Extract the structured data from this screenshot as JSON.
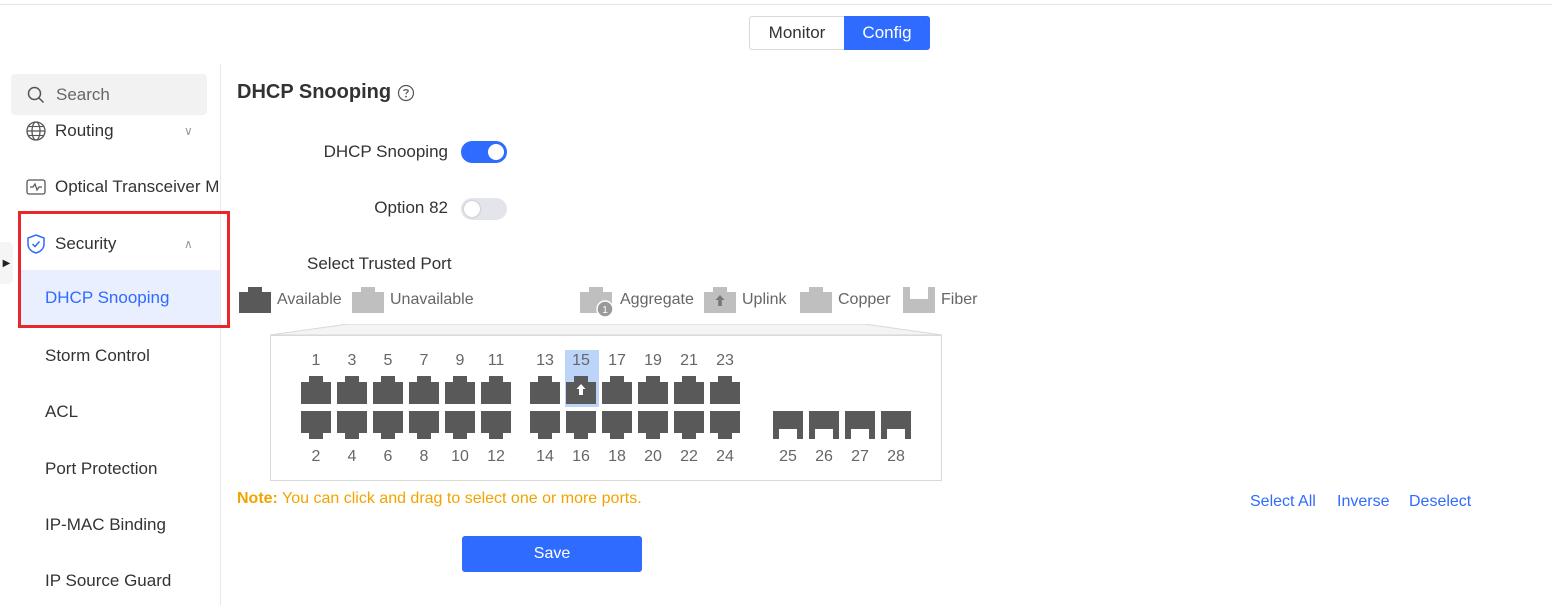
{
  "header": {
    "modes": {
      "monitor": "Monitor",
      "config": "Config",
      "active": "config"
    }
  },
  "sidebar": {
    "search_placeholder": "Search",
    "items": [
      {
        "label": "Routing",
        "icon": "globe-icon",
        "expanded": false
      },
      {
        "label": "Optical Transceiver Ma",
        "icon": "monitor-pulse-icon"
      },
      {
        "label": "Security",
        "icon": "shield-icon",
        "expanded": true
      }
    ],
    "security_children": [
      {
        "label": "DHCP Snooping",
        "active": true
      },
      {
        "label": "Storm Control"
      },
      {
        "label": "ACL"
      },
      {
        "label": "Port Protection"
      },
      {
        "label": "IP-MAC Binding"
      },
      {
        "label": "IP Source Guard"
      }
    ]
  },
  "main": {
    "title": "DHCP Snooping",
    "dhcp_snooping_label": "DHCP Snooping",
    "dhcp_snooping_enabled": true,
    "option82_label": "Option 82",
    "option82_enabled": false,
    "trusted_port_label": "Select Trusted Port",
    "legend": {
      "available": "Available",
      "unavailable": "Unavailable",
      "aggregate": "Aggregate",
      "aggregate_badge": "1",
      "uplink": "Uplink",
      "copper": "Copper",
      "fiber": "Fiber"
    },
    "ports_top": [
      "1",
      "3",
      "5",
      "7",
      "9",
      "11",
      "13",
      "15",
      "17",
      "19",
      "21",
      "23"
    ],
    "ports_bottom": [
      "2",
      "4",
      "6",
      "8",
      "10",
      "12",
      "14",
      "16",
      "18",
      "20",
      "22",
      "24"
    ],
    "ports_fiber": [
      "25",
      "26",
      "27",
      "28"
    ],
    "selected_port": "15",
    "uplink_port": "15",
    "note_prefix": "Note:",
    "note_text": " You can click and drag to select one or more ports.",
    "actions": {
      "select_all": "Select All",
      "inverse": "Inverse",
      "deselect": "Deselect"
    },
    "save_label": "Save"
  },
  "colors": {
    "accent": "#2f6bff",
    "port_available": "#595959",
    "port_unavailable": "#bfbfbf",
    "note": "#f0a400",
    "highlight_box": "#e8262c"
  }
}
